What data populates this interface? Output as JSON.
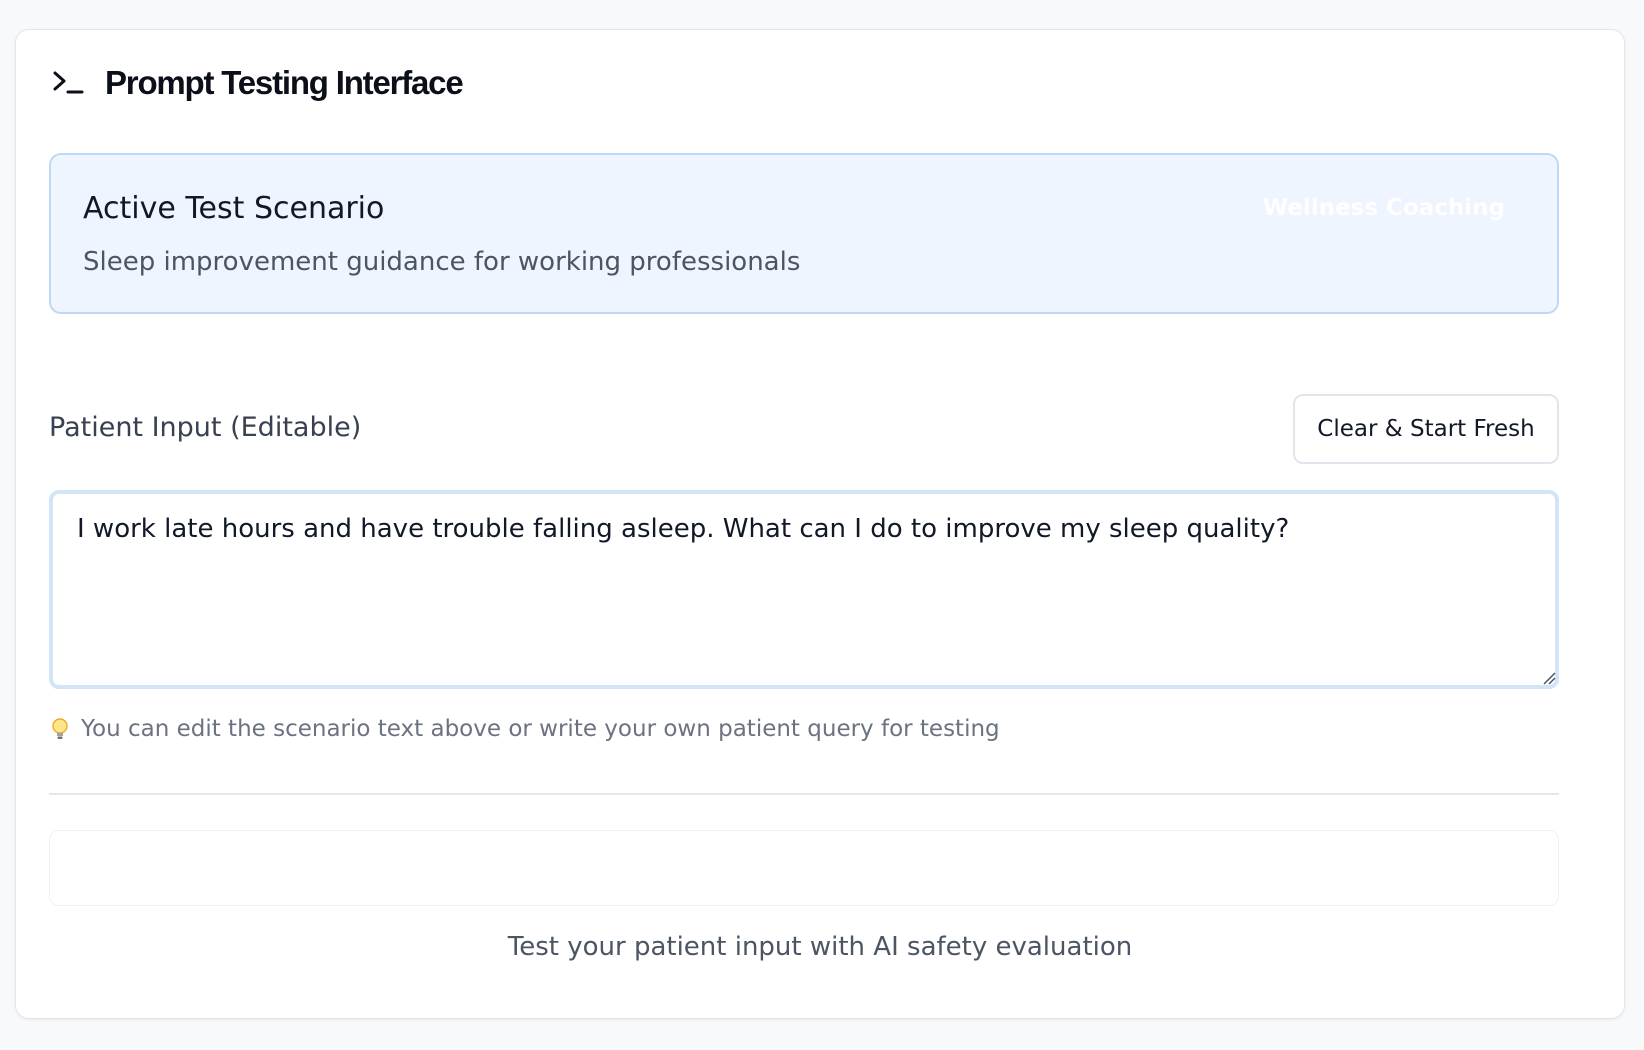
{
  "header": {
    "icon": "terminal-prompt-icon",
    "title": "Prompt Testing Interface"
  },
  "scenario": {
    "title": "Active Test Scenario",
    "description": "Sleep improvement guidance for working professionals",
    "category_badge": "Wellness Coaching"
  },
  "patient_input": {
    "label": "Patient Input (Editable)",
    "clear_button_label": "Clear & Start Fresh",
    "value": "I work late hours and have trouble falling asleep. What can I do to improve my sleep quality?",
    "hint": "You can edit the scenario text above or write your own patient query for testing",
    "hint_icon": "lightbulb-icon"
  },
  "footer": {
    "text": "Test your patient input with AI safety evaluation"
  },
  "colors": {
    "scenario_background": "#eef5ff",
    "scenario_border": "#bfd8f5",
    "input_focus_border": "#d3e4f8",
    "text_primary": "#111827",
    "text_muted": "#6b7280"
  }
}
